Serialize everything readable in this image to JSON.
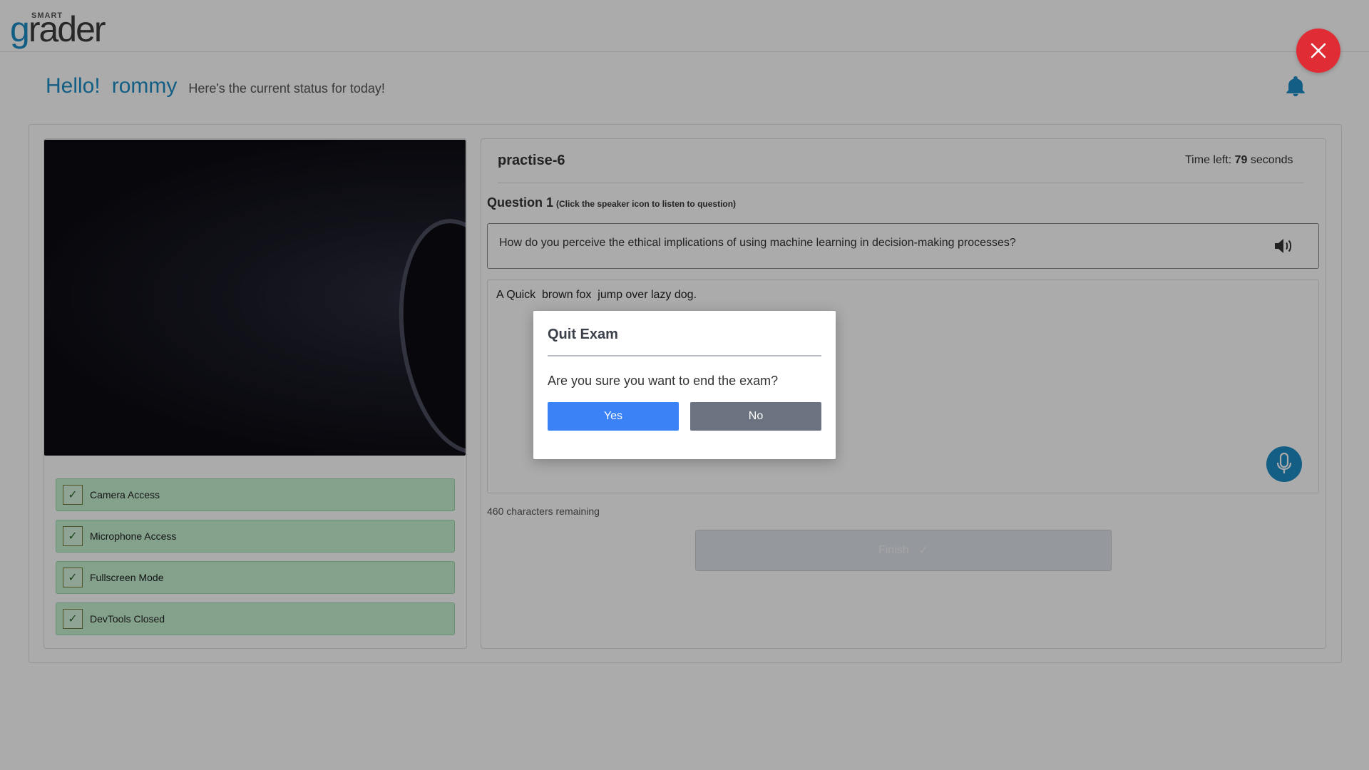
{
  "header": {
    "logo_small": "SMART",
    "logo_main_g": "g",
    "logo_main_rest": "rader"
  },
  "greeting": {
    "hello": "Hello!",
    "name": "rommy",
    "status": "Here's the current status for today!"
  },
  "icons": {
    "bell": "bell-icon",
    "close": "close-icon",
    "speaker": "speaker-icon",
    "mic": "microphone-icon",
    "check": "check-icon"
  },
  "checks": [
    {
      "label": "Camera Access"
    },
    {
      "label": "Microphone Access"
    },
    {
      "label": "Fullscreen Mode"
    },
    {
      "label": "DevTools Closed"
    }
  ],
  "exam": {
    "title": "practise-6",
    "time_prefix": "Time left:",
    "time_value": "79",
    "time_suffix": "seconds",
    "question_label": "Question 1",
    "question_hint": "(Click the speaker icon to listen to question)",
    "question_text": "How do you perceive the ethical implications of using machine learning in decision-making processes?",
    "answer_text": "A Quick  brown fox  jump over lazy dog.",
    "chars_remaining": "460 characters remaining",
    "finish_label": "Finish"
  },
  "modal": {
    "title": "Quit Exam",
    "text": "Are you sure you want to end the exam?",
    "yes_label": "Yes",
    "no_label": "No"
  },
  "colors": {
    "brand": "#1d8cc6",
    "close": "#e02d35",
    "yes": "#3b82f6",
    "no": "#6b7280",
    "check_bg": "#c4f0d0"
  }
}
